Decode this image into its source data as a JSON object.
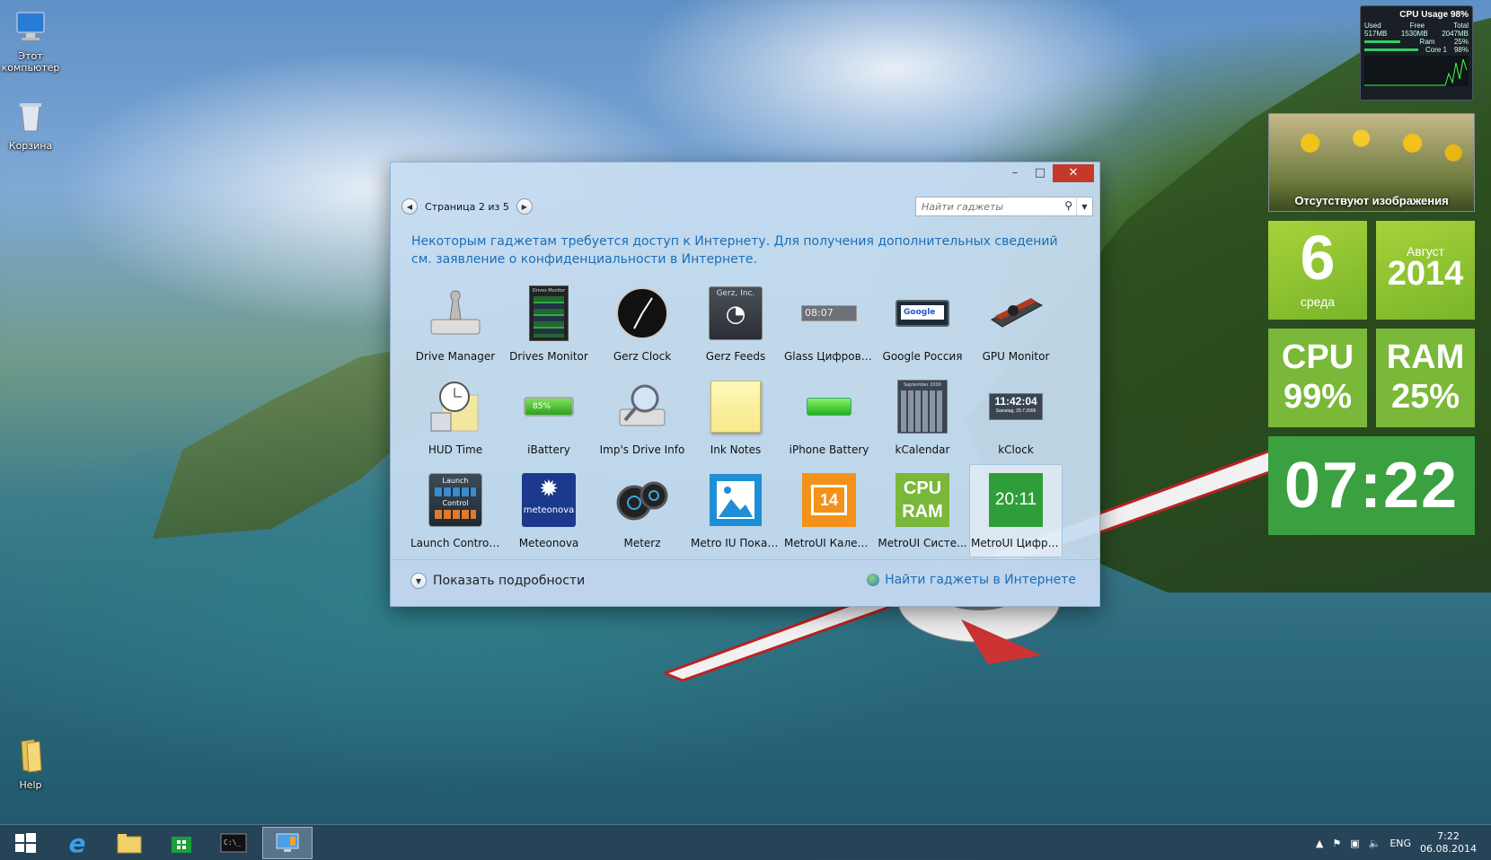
{
  "desktop": {
    "icons": [
      {
        "label": "Этот компьютер"
      },
      {
        "label": "Корзина"
      },
      {
        "label": "Help"
      }
    ]
  },
  "window": {
    "nav": {
      "page_text": "Страница 2 из 5"
    },
    "search": {
      "placeholder": "Найти гаджеты"
    },
    "info_text": "Некоторым гаджетам требуется доступ к Интернету. Для получения дополнительных сведений см. заявление о конфиденциальности в Интернете.",
    "gadgets": [
      {
        "label": "Drive Manager",
        "icon": "drive-manager-icon"
      },
      {
        "label": "Drives Monitor",
        "icon": "drives-monitor-icon",
        "icon_text": "Drives Monitor"
      },
      {
        "label": "Gerz Clock",
        "icon": "gerz-clock-icon"
      },
      {
        "label": "Gerz Feeds",
        "icon": "gerz-feeds-icon",
        "icon_text": "Gerz, Inc."
      },
      {
        "label": "Glass Цифровы...",
        "icon": "glass-digital-clock-icon",
        "icon_text": "08:07"
      },
      {
        "label": "Google Россия",
        "icon": "google-russia-icon",
        "icon_text": "Google"
      },
      {
        "label": "GPU Monitor",
        "icon": "gpu-monitor-icon"
      },
      {
        "label": "HUD Time",
        "icon": "hud-time-icon"
      },
      {
        "label": "iBattery",
        "icon": "ibattery-icon",
        "icon_text": "85%"
      },
      {
        "label": "Imp's Drive Info",
        "icon": "drive-info-icon"
      },
      {
        "label": "Ink Notes",
        "icon": "ink-notes-icon"
      },
      {
        "label": "iPhone Battery",
        "icon": "iphone-battery-icon"
      },
      {
        "label": "kCalendar",
        "icon": "kcalendar-icon",
        "icon_text": "September 2000"
      },
      {
        "label": "kClock",
        "icon": "kclock-icon",
        "icon_text": "11:42:04",
        "icon_subtext": "Samstag, 29.7.2006"
      },
      {
        "label": "Launch Control ...",
        "icon": "launch-control-icon",
        "icon_text": "Launch",
        "icon_subtext": "Control"
      },
      {
        "label": "Meteonova",
        "icon": "meteonova-icon",
        "icon_text": "meteonova"
      },
      {
        "label": "Meterz",
        "icon": "meterz-icon"
      },
      {
        "label": "Metro IU Показ ...",
        "icon": "metro-photo-icon"
      },
      {
        "label": "MetroUI Календ...",
        "icon": "metro-calendar-icon",
        "icon_text": "14"
      },
      {
        "label": "MetroUI Систе...",
        "icon": "metro-system-icon",
        "icon_text": "CPU",
        "icon_subtext": "RAM"
      },
      {
        "label": "MetroUI Цифро...",
        "icon": "metro-digital-clock-icon",
        "icon_text": "20:11",
        "selected": true
      }
    ],
    "footer": {
      "details_label": "Показать подробности",
      "online_link": "Найти гаджеты в Интернете"
    }
  },
  "sidebar": {
    "cpu_monitor": {
      "title": "CPU Usage 98%",
      "headers": [
        "Used",
        "Free",
        "Total"
      ],
      "values": [
        "517MB",
        "1530MB",
        "2047MB"
      ],
      "ram_label": "Ram",
      "ram_pct": "25%",
      "core_label": "Core 1",
      "core_pct": "98%"
    },
    "photo": {
      "caption": "Отсутствуют изображения"
    },
    "date": {
      "day": "6",
      "weekday": "среда",
      "month": "Август",
      "year": "2014"
    },
    "cpu": {
      "label": "CPU",
      "value": "99%"
    },
    "ram": {
      "label": "RAM",
      "value": "25%"
    },
    "clock": {
      "time": "07:22"
    }
  },
  "taskbar": {
    "tray": {
      "lang": "ENG",
      "time": "7:22",
      "date": "06.08.2014"
    }
  },
  "colors": {
    "accent_blue": "#1a6eb8",
    "close_red": "#c7382c",
    "tile_green": "#7ab83a",
    "clock_green": "#3aa040"
  }
}
